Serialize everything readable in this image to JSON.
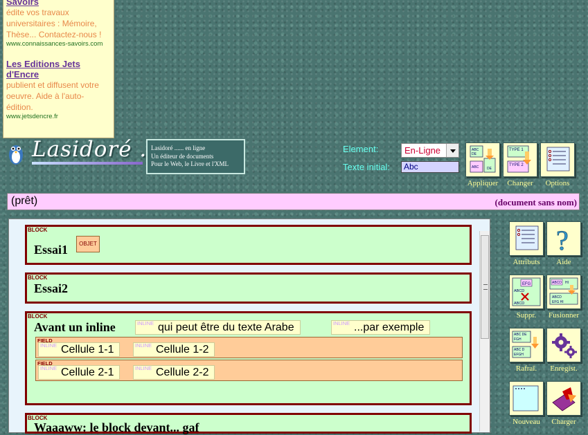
{
  "ads": [
    {
      "title": "Savoirs",
      "desc": "édite vos travaux universitaires : Mémoire, Thèse... Contactez-nous !",
      "url": "www.connaissances-savoirs.com"
    },
    {
      "title": "Les Editions Jets d'Encre",
      "desc": "publient et diffusent votre oeuvre. Aide à l'auto-édition.",
      "url": "www.jetsdencre.fr"
    }
  ],
  "logo": {
    "text": "Lasidoré ..."
  },
  "tagline": {
    "line1": "Lasidoré ...... en ligne",
    "line2": "Un éditeur de documents",
    "line3": "Pour le Web, le Livre et l'XML"
  },
  "element": {
    "label": "Element:",
    "value": "En-Ligne"
  },
  "texte_initial": {
    "label": "Texte initial:",
    "value": "Abc"
  },
  "top_tools": [
    {
      "label": "Appliquer",
      "icon": "apply-icon"
    },
    {
      "label": "Changer",
      "icon": "change-type-icon"
    },
    {
      "label": "Options",
      "icon": "options-icon"
    }
  ],
  "side_tools": [
    {
      "label": "Attributs",
      "icon": "attributes-icon"
    },
    {
      "label": "Aide",
      "icon": "help-icon"
    },
    {
      "label": "Suppr.",
      "icon": "delete-icon"
    },
    {
      "label": "Fusionner",
      "icon": "merge-icon"
    },
    {
      "label": "Rafraî.",
      "icon": "refresh-icon"
    },
    {
      "label": "Enregist.",
      "icon": "save-gears-icon"
    },
    {
      "label": "Nouveau",
      "icon": "new-doc-icon"
    },
    {
      "label": "Charger",
      "icon": "load-icon"
    }
  ],
  "status": {
    "left": "(prêt)",
    "right": "(document sans nom)"
  },
  "tags": {
    "block": "BLOCK",
    "inline": "INLINE",
    "field": "FIELD",
    "objet": "OBJET"
  },
  "blocks": [
    {
      "title": "Essai1"
    },
    {
      "title": "Essai2"
    },
    {
      "title": "Avant un inline",
      "inline1": "qui peut être du texte Arabe",
      "inline2": "...par exemple",
      "cells": [
        [
          "Cellule 1-1",
          "Cellule 1-2"
        ],
        [
          "Cellule 2-1",
          "Cellule 2-2"
        ]
      ]
    },
    {
      "title": "Waaaww: le block devant... gaf"
    }
  ],
  "colors": {
    "status_bg": "#ffccff",
    "block_bg": "#ccffcc",
    "block_border": "#800000",
    "inline_bg": "#ffffcc",
    "field_bg": "#ffcc99"
  }
}
